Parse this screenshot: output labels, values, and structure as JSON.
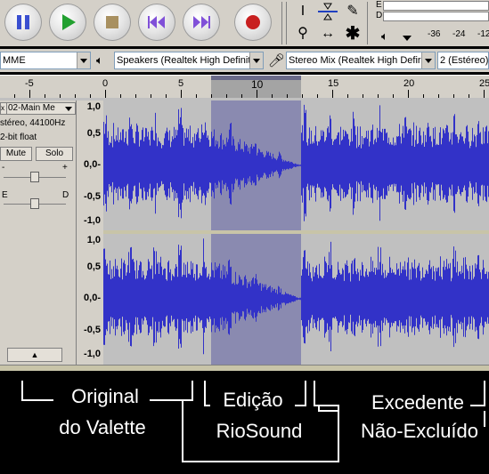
{
  "toolbar": {
    "buttons": [
      {
        "name": "pause-button",
        "icon": "pause-icon",
        "color": "#3a4fd0"
      },
      {
        "name": "play-button",
        "icon": "play-icon",
        "color": "#1a9a28"
      },
      {
        "name": "stop-button",
        "icon": "stop-icon",
        "color": "#a08850"
      },
      {
        "name": "skip-start-button",
        "icon": "skip-start-icon",
        "color": "#7a4ad0"
      },
      {
        "name": "skip-end-button",
        "icon": "skip-end-icon",
        "color": "#7a4ad0"
      },
      {
        "name": "record-button",
        "icon": "record-icon",
        "color": "#c02020"
      }
    ]
  },
  "meter": {
    "left_label": "E",
    "right_label": "D",
    "scale": [
      "-36",
      "-24",
      "-12"
    ]
  },
  "devices": {
    "host": "MME",
    "output": "Speakers (Realtek High Definit",
    "input": "Stereo Mix (Realtek High Defir",
    "channels": "2 (Estéreo)"
  },
  "ruler": {
    "labels": [
      "-5",
      "0",
      "5",
      "10",
      "15",
      "20",
      "25"
    ]
  },
  "track": {
    "name": "02-Main Me",
    "info_line1": "stéreo, 44100Hz",
    "info_line2": "2-bit float",
    "mute_label": "Mute",
    "solo_label": "Solo",
    "gain_minus": "-",
    "gain_plus": "+",
    "pan_left": "E",
    "pan_right": "D",
    "collapse_label": "▲"
  },
  "vertical_scale": [
    "1,0",
    "0,5",
    "0,0-",
    "-0,5",
    "-1,0"
  ],
  "waveform_color": "#3232c8",
  "selection_color": "#8a8ab0",
  "captions": {
    "original_line1": "Original",
    "original_line2": "do Valette",
    "edit_line1": "Edição",
    "edit_line2": "RioSound",
    "excess_line1": "Excedente",
    "excess_line2": "Não-Excluído"
  }
}
